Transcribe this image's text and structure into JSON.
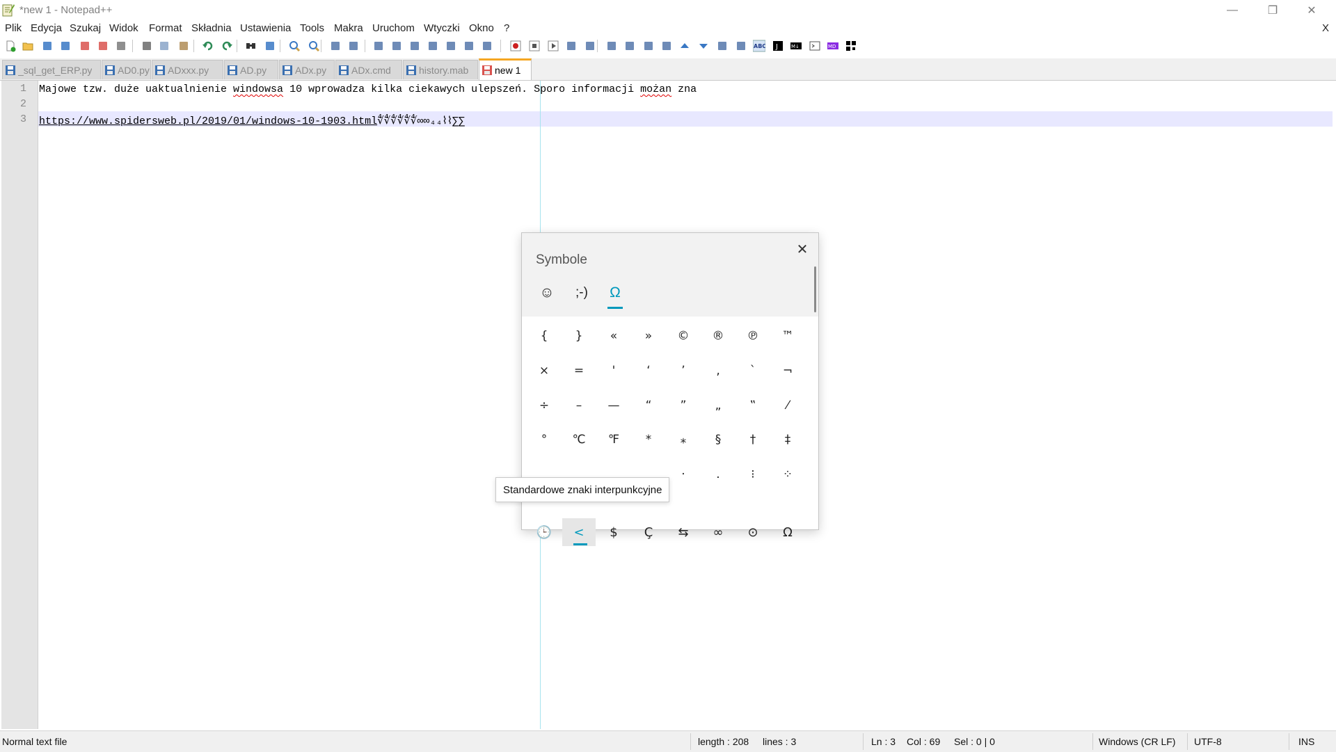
{
  "window": {
    "title": "*new 1 - Notepad++",
    "minimize_glyph": "—",
    "restore_glyph": "❐",
    "close_glyph": "✕"
  },
  "menu": {
    "items": [
      "Plik",
      "Edycja",
      "Szukaj",
      "Widok",
      "Format",
      "Składnia",
      "Ustawienia",
      "Tools",
      "Makra",
      "Uruchom",
      "Wtyczki",
      "Okno",
      "?"
    ],
    "doc_close": "X"
  },
  "toolbar": {
    "icons": [
      "new-file-icon",
      "open-file-icon",
      "save-icon",
      "save-all-icon",
      "close-icon",
      "close-all-icon",
      "print-icon",
      "cut-icon",
      "copy-icon",
      "paste-icon",
      "undo-icon",
      "redo-icon",
      "find-icon",
      "replace-icon",
      "zoom-in-icon",
      "zoom-out-icon",
      "sync-vertical-icon",
      "sync-horizontal-icon",
      "word-wrap-icon",
      "show-all-chars-icon",
      "indent-guide-icon",
      "document-map-icon",
      "function-list-icon",
      "folder-as-workspace-icon",
      "monitoring-icon",
      "record-macro-icon",
      "stop-record-icon",
      "play-macro-icon",
      "run-macro-multiple-icon",
      "save-macro-icon",
      "insert-icon",
      "list-icon",
      "list-alt-icon",
      "collapse-icon",
      "up-arrow-icon",
      "down-arrow-icon",
      "expand-icon",
      "compare-icon",
      "spell-check-icon",
      "json-icon",
      "markdown-icon",
      "terminal-icon",
      "md-icon",
      "qr-icon"
    ]
  },
  "tabs": [
    {
      "label": "_sql_get_ERP.py",
      "active": false
    },
    {
      "label": "AD0.py",
      "active": false
    },
    {
      "label": "ADxxx.py",
      "active": false
    },
    {
      "label": "AD.py",
      "active": false
    },
    {
      "label": "ADx.py",
      "active": false
    },
    {
      "label": "ADx.cmd",
      "active": false
    },
    {
      "label": "history.mab",
      "active": false
    },
    {
      "label": "new 1",
      "active": true
    }
  ],
  "editor": {
    "line_numbers": [
      "1",
      "2",
      "3"
    ],
    "line1_parts": [
      "Majowe tzw. duże uaktualnienie ",
      "windowsa",
      " 10 wprowadza kilka ciekawych ulepszeń. Sporo informacji ",
      "możan",
      " zna"
    ],
    "line2": "",
    "line3_url": "https://www.spidersweb.pl/2019/01/windows-10-1903.html",
    "line3_tail": "∜∜∜∜∜∜∞∞₄₄⌇⌇∑∑"
  },
  "symbol_panel": {
    "title": "Symbole",
    "close_glyph": "✕",
    "tabs": [
      "☺",
      ";-)",
      "Ω"
    ],
    "rows": [
      [
        "{",
        "}",
        "«",
        "»",
        "©",
        "®",
        "℗",
        "™"
      ],
      [
        "×",
        "=",
        "'",
        "‘",
        "’",
        "‚",
        "`",
        "¬"
      ],
      [
        "÷",
        "–",
        "—",
        "“",
        "”",
        "„",
        "‟",
        "⁄"
      ],
      [
        "°",
        "℃",
        "℉",
        "*",
        "⁎",
        "§",
        "†",
        "‡"
      ],
      [
        "",
        "",
        "",
        "",
        "·",
        ".",
        "⁝",
        "⁘"
      ]
    ],
    "categories": [
      "🕒",
      "<",
      "$",
      "Ç",
      "⇆",
      "∞",
      "⊙",
      "Ω"
    ],
    "tooltip": "Standardowe znaki interpunkcyjne"
  },
  "status": {
    "file_type": "Normal text file",
    "length": "length : 208",
    "lines": "lines : 3",
    "ln": "Ln : 3",
    "col": "Col : 69",
    "sel": "Sel : 0 | 0",
    "eol": "Windows (CR LF)",
    "encoding": "UTF-8",
    "mode": "INS"
  },
  "colors": {
    "accent_tab": "#f5a623",
    "edge_line": "#a6e3ee",
    "current_line": "#e8e8ff",
    "symbol_accent": "#0099bc"
  }
}
